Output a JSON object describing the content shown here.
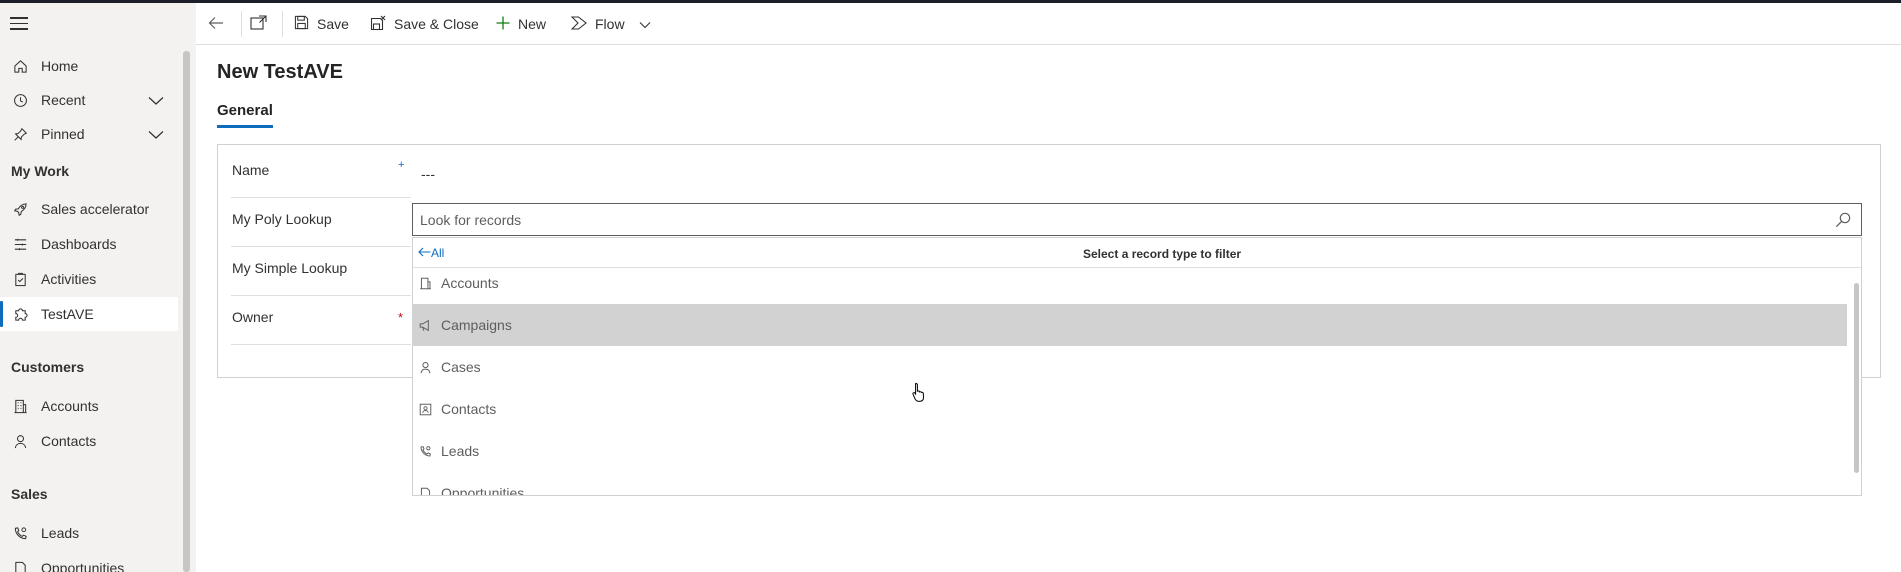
{
  "sidebar": {
    "items": [
      {
        "label": "Home",
        "icon": "home-icon"
      },
      {
        "label": "Recent",
        "icon": "clock-icon"
      },
      {
        "label": "Pinned",
        "icon": "pin-icon"
      }
    ],
    "groups": {
      "my_work": "My Work",
      "customers": "Customers",
      "sales": "Sales"
    },
    "my_work_items": [
      {
        "label": "Sales accelerator",
        "icon": "rocket-icon"
      },
      {
        "label": "Dashboards",
        "icon": "dashboard-icon"
      },
      {
        "label": "Activities",
        "icon": "clipboard-icon"
      },
      {
        "label": "TestAVE",
        "icon": "puzzle-icon"
      }
    ],
    "customers_items": [
      {
        "label": "Accounts",
        "icon": "building-icon"
      },
      {
        "label": "Contacts",
        "icon": "person-icon"
      }
    ],
    "sales_items": [
      {
        "label": "Leads",
        "icon": "phone-person-icon"
      },
      {
        "label": "Opportunities",
        "icon": "document-icon"
      }
    ],
    "active": "TestAVE"
  },
  "toolbar": {
    "save": "Save",
    "save_close": "Save & Close",
    "new": "New",
    "flow": "Flow"
  },
  "form": {
    "title": "New TestAVE",
    "tab": "General",
    "fields": {
      "name_label": "Name",
      "name_value": "---",
      "poly_label": "My Poly Lookup",
      "simple_label": "My Simple Lookup",
      "owner_label": "Owner",
      "required_mark": "*",
      "recommended_mark": "+"
    }
  },
  "lookup": {
    "placeholder": "Look for records",
    "all_label": "All",
    "filter_hint": "Select a record type to filter",
    "options": [
      "Accounts",
      "Campaigns",
      "Cases",
      "Contacts",
      "Leads",
      "Opportunities"
    ],
    "hovered": "Campaigns"
  },
  "colors": {
    "accent": "#0f6cbd",
    "required": "#c50f1f",
    "hover_row": "#d2d2d2"
  }
}
